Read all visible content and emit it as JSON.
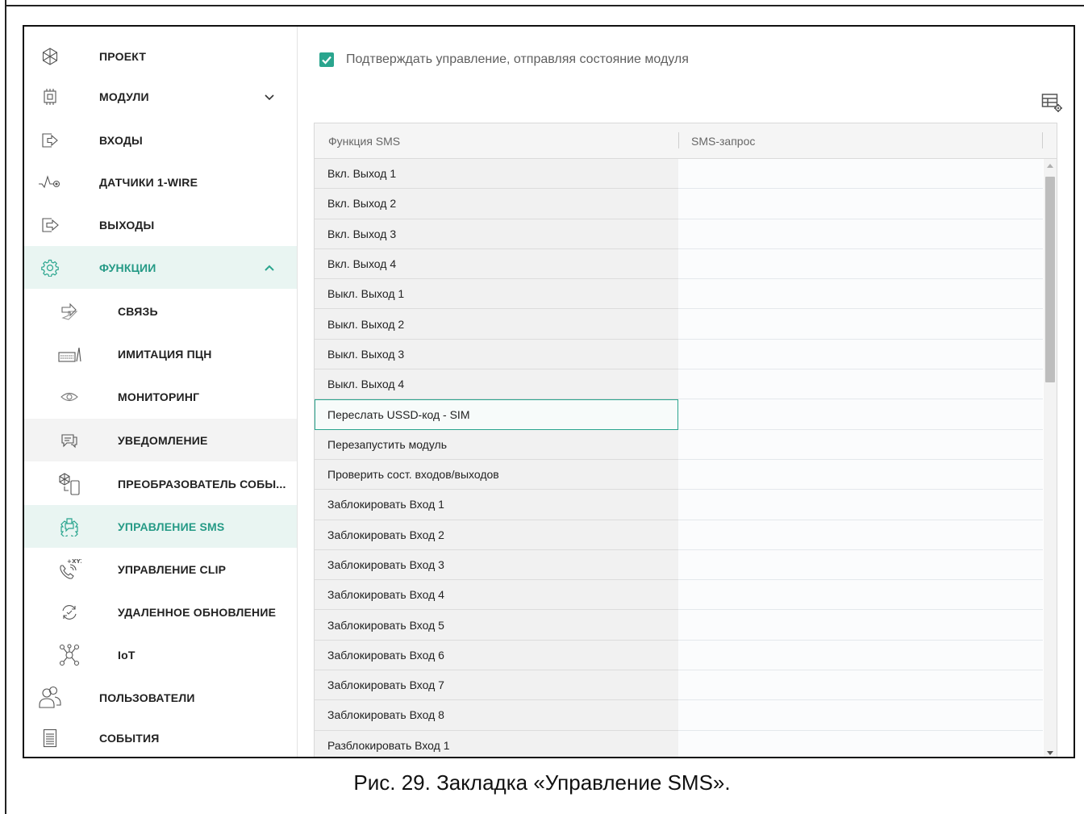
{
  "sidebar": {
    "items": [
      {
        "label": "ПРОЕКТ",
        "icon": "project-icon"
      },
      {
        "label": "МОДУЛИ",
        "icon": "module-icon",
        "expanded": false
      },
      {
        "label": "ВХОДЫ",
        "icon": "input-icon"
      },
      {
        "label": "ДАТЧИКИ 1-WIRE",
        "icon": "sensor-icon"
      },
      {
        "label": "ВЫХОДЫ",
        "icon": "output-icon"
      },
      {
        "label": "ФУНКЦИИ",
        "icon": "gear-icon",
        "expanded": true
      },
      {
        "label": "СВЯЗЬ",
        "icon": "communication-icon"
      },
      {
        "label": "ИМИТАЦИЯ ПЦН",
        "icon": "station-emulation-icon"
      },
      {
        "label": "МОНИТОРИНГ",
        "icon": "eye-icon"
      },
      {
        "label": "УВЕДОМЛЕНИЕ",
        "icon": "notification-icon"
      },
      {
        "label": "ПРЕОБРАЗОВАТЕЛЬ СОБЫ...",
        "icon": "event-converter-icon"
      },
      {
        "label": "УПРАВЛЕНИЕ SMS",
        "icon": "sms-control-icon"
      },
      {
        "label": "УПРАВЛЕНИЕ CLIP",
        "icon": "clip-control-icon"
      },
      {
        "label": "УДАЛЕННОЕ ОБНОВЛЕНИЕ",
        "icon": "remote-update-icon"
      },
      {
        "label": "IoT",
        "icon": "iot-icon"
      },
      {
        "label": "ПОЛЬЗОВАТЕЛИ",
        "icon": "users-icon"
      },
      {
        "label": "СОБЫТИЯ",
        "icon": "events-icon"
      }
    ]
  },
  "main": {
    "confirm_checkbox": {
      "label": "Подтверждать управление, отправляя состояние модуля",
      "checked": true
    },
    "table": {
      "headers": [
        "Функция SMS",
        "SMS-запрос"
      ],
      "rows": [
        "Вкл. Выход 1",
        "Вкл. Выход 2",
        "Вкл. Выход 3",
        "Вкл. Выход 4",
        "Выкл. Выход 1",
        "Выкл. Выход 2",
        "Выкл. Выход 3",
        "Выкл. Выход 4",
        "Переслать USSD-код - SIM",
        "Перезапустить модуль",
        "Проверить сост. входов/выходов",
        "Заблокировать Вход 1",
        "Заблокировать Вход 2",
        "Заблокировать Вход 3",
        "Заблокировать Вход 4",
        "Заблокировать Вход 5",
        "Заблокировать Вход 6",
        "Заблокировать Вход 7",
        "Заблокировать Вход 8",
        "Разблокировать Вход 1"
      ]
    }
  },
  "caption": "Рис. 29. Закладка «Управление SMS».",
  "colors": {
    "accent": "#2aa58e",
    "active_bg": "#e9f5f2",
    "active_text": "#259a86"
  }
}
